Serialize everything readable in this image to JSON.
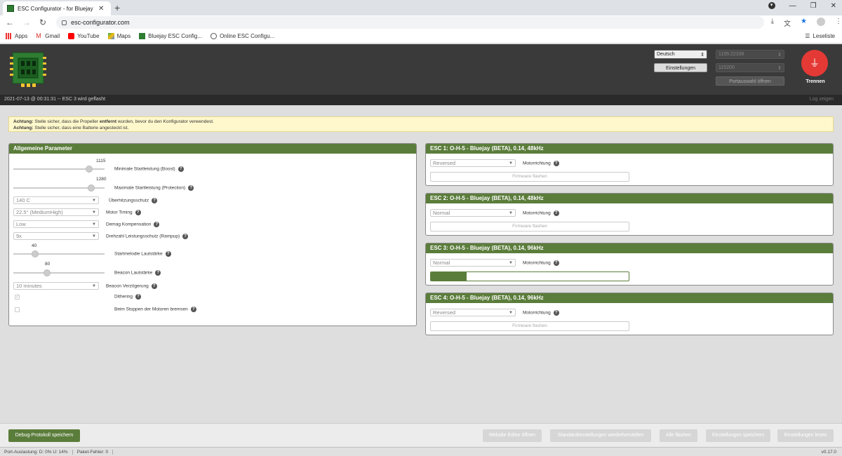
{
  "browser": {
    "tab_title": "ESC Configurator - for Bluejay",
    "url": "esc-configurator.com",
    "bookmarks": [
      "Apps",
      "Gmail",
      "YouTube",
      "Maps",
      "Bluejay ESC Config...",
      "Online ESC Configu..."
    ],
    "reading_list": "Leseliste"
  },
  "header": {
    "language": "Deutsch",
    "port": "1155:22336",
    "baud": "115200",
    "settings_button": "Einstellungen",
    "port_open_button": "Portauswahl öffnen",
    "disconnect_label": "Trennen"
  },
  "status": {
    "message": "2021-07-13 @ 00:31:31 -- ESC 3 wird geflasht",
    "log_button": "Log zeigen"
  },
  "warning": {
    "label1": "Achtung:",
    "text1a": "Stelle sicher, dass die Propeller",
    "text1b": "entfernt",
    "text1c": "wurden, bevor du den Konfigurator verwendest.",
    "label2": "Achtung:",
    "text2": "Stelle sicher, dass eine Batterie angesteckt ist."
  },
  "general": {
    "title": "Allgemeine Parameter",
    "startup_boost_value": "1115",
    "startup_boost_label": "Minimale Startleistung (Boost)",
    "startup_protection_value": "1280",
    "startup_protection_label": "Maximale Startleistung (Protection)",
    "temp_value": "140 C",
    "temp_label": "Überhitzungsschutz",
    "timing_value": "22.5° (MediumHigh)",
    "timing_label": "Motor Timing",
    "demag_value": "Low",
    "demag_label": "Demag Kompensation",
    "rampup_value": "9x",
    "rampup_label": "Drehzahl Leistungsschutz (Rampup)",
    "melody_volume_value": "40",
    "melody_volume_label": "Startmelodie Lautstärke",
    "beacon_volume_value": "80",
    "beacon_volume_label": "Beacon Lautstärke",
    "beacon_delay_value": "10 minutes",
    "beacon_delay_label": "Beacon Verzögerung",
    "dithering_label": "Dithering",
    "brake_label": "Beim Stoppen der Motoren bremsen",
    "slider_levels": {
      "startup_boost": 0.86,
      "startup_protection": 0.88,
      "melody_volume": 0.22,
      "beacon_volume": 0.36
    }
  },
  "escs": [
    {
      "title": "ESC 1: O-H-5 - Bluejay (BETA), 0.14, 48kHz",
      "direction": "Reversed",
      "direction_label": "Motorrichtung",
      "flash_label": "Firmware flashen",
      "flashing": false,
      "progress": 0
    },
    {
      "title": "ESC 2: O-H-5 - Bluejay (BETA), 0.14, 48kHz",
      "direction": "Normal",
      "direction_label": "Motorrichtung",
      "flash_label": "Firmware flashen",
      "flashing": false,
      "progress": 0
    },
    {
      "title": "ESC 3: O-H-5 - Bluejay (BETA), 0.14, 96kHz",
      "direction": "Normal",
      "direction_label": "Motorrichtung",
      "flash_label": "",
      "flashing": true,
      "progress": 0.18
    },
    {
      "title": "ESC 4: O-H-5 - Bluejay (BETA), 0.14, 96kHz",
      "direction": "Reversed",
      "direction_label": "Motorrichtung",
      "flash_label": "Firmware flashen",
      "flashing": false,
      "progress": 0
    }
  ],
  "actions": {
    "debug_save": "Debug-Protokoll speichern",
    "melody_editor": "Melodie Editor öffnen",
    "restore_defaults": "Standardeinstellungen wiederherstellen",
    "flash_all": "Alle flashen",
    "save_settings": "Einstellungen speichern",
    "read_settings": "Einstellungen lesen"
  },
  "footer": {
    "port_usage": "Port-Auslastung: D: 0% U: 14%",
    "packet_errors": "Paket-Fehler: 0",
    "version": "v0.17.0"
  },
  "colors": {
    "accent": "#5b7d3b",
    "disconnect": "#e53935",
    "warning_bg": "#fff8cc"
  }
}
